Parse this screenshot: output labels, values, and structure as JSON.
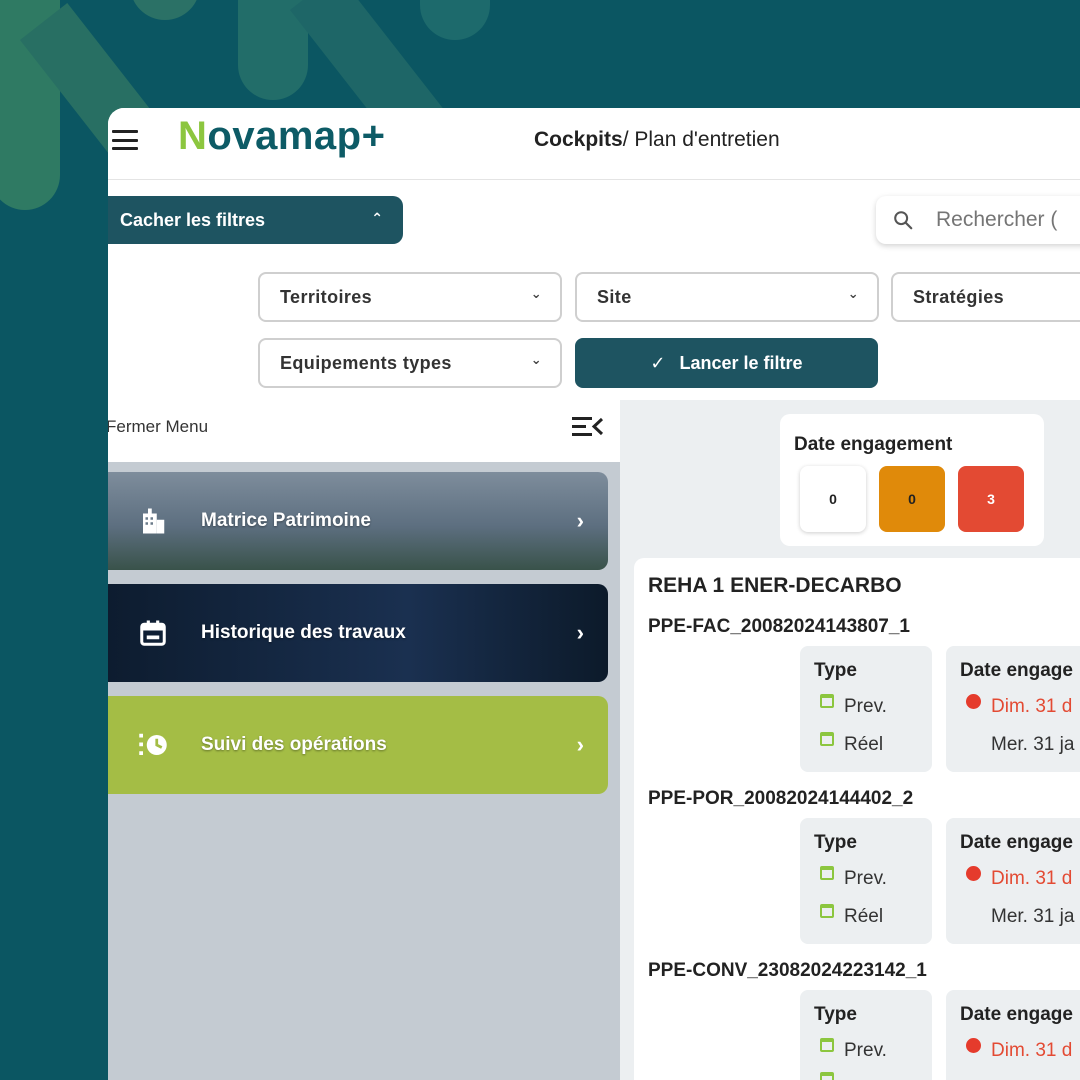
{
  "colors": {
    "background": "#0b5662",
    "primary": "#1e5461",
    "accent_green": "#8cc63f",
    "suivi_card": "#a4bd45",
    "orange": "#e08a0a",
    "red": "#e34a33"
  },
  "header": {
    "logo_first_letter": "N",
    "logo_rest": "ovamap",
    "logo_plus": "+",
    "breadcrumb_root": "Cockpits",
    "breadcrumb_sep": "/ ",
    "breadcrumb_page": "Plan d'entretien",
    "menu_icon": "hamburger-icon"
  },
  "toolbar": {
    "hide_filters_label": "Cacher les filtres",
    "search_placeholder": "Rechercher (",
    "search_icon": "search-icon"
  },
  "filters": {
    "territoires": "Territoires",
    "site": "Site",
    "strategies": "Stratégies",
    "equipements_types": "Equipements types",
    "run_label": "Lancer le filtre"
  },
  "side_menu": {
    "close_label": "Fermer Menu",
    "items": [
      {
        "label": "Matrice Patrimoine",
        "icon": "building-icon"
      },
      {
        "label": "Historique des travaux",
        "icon": "calendar-icon"
      },
      {
        "label": "Suivi des opérations",
        "icon": "clock-progress-icon"
      }
    ]
  },
  "date_summary": {
    "title": "Date engagement",
    "counts": [
      {
        "value": "0",
        "color": "#ffffff"
      },
      {
        "value": "0",
        "color": "#e08a0a"
      },
      {
        "value": "3",
        "color": "#e34a33"
      }
    ]
  },
  "operations": {
    "group_title": "REHA 1 ENER-DECARBO",
    "items": [
      {
        "id": "PPE-FAC_20082024143807_1",
        "type_header": "Type",
        "date_header": "Date engage",
        "prev_label": "Prev.",
        "reel_label": "Réel",
        "prev_date": "Dim. 31 d",
        "reel_date": "Mer. 31 ja"
      },
      {
        "id": "PPE-POR_20082024144402_2",
        "type_header": "Type",
        "date_header": "Date engage",
        "prev_label": "Prev.",
        "reel_label": "Réel",
        "prev_date": "Dim. 31 d",
        "reel_date": "Mer. 31 ja"
      },
      {
        "id": "PPE-CONV_23082024223142_1",
        "type_header": "Type",
        "date_header": "Date engage",
        "prev_label": "Prev.",
        "prev_date": "Dim. 31 d"
      }
    ]
  }
}
